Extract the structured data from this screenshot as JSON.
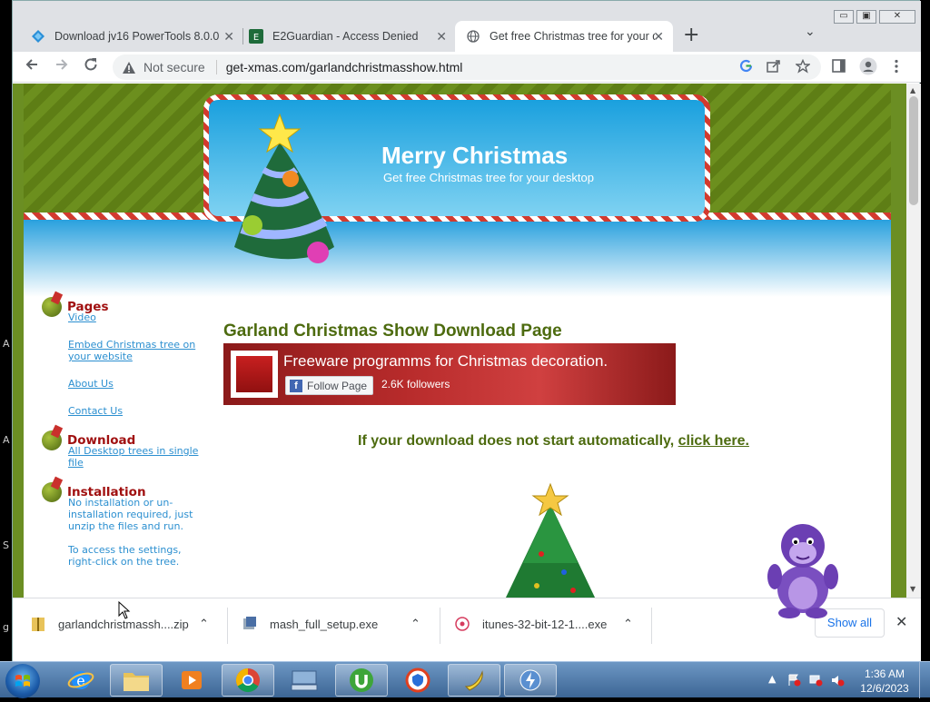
{
  "browser": {
    "tabs": [
      {
        "title": "Download jv16 PowerTools 8.0.0",
        "close": "✕"
      },
      {
        "title": "E2Guardian - Access Denied",
        "close": "✕"
      },
      {
        "title": "Get free Christmas tree for your d",
        "close": "✕"
      }
    ],
    "new_tab": "+",
    "tab_list": "⌄",
    "window_controls": {
      "minimize": "▭",
      "maximize": "▣",
      "close": "✕"
    },
    "security": "Not secure",
    "url": "get-xmas.com/garlandchristmasshow.html"
  },
  "page": {
    "banner_title": "Merry Christmas",
    "banner_subtitle": "Get free Christmas tree for your desktop",
    "nav": {
      "pages_heading": "Pages",
      "video": "Video",
      "embed": "Embed Christmas tree on your website",
      "about": "About Us",
      "contact": "Contact Us",
      "download_heading": "Download",
      "all_trees": "All Desktop trees in single file",
      "installation_heading": "Installation",
      "install_text": "No installation or un-installation required, just unzip the files and run.",
      "settings_text": "To access the settings, right-click on the tree."
    },
    "heading": "Garland Christmas Show Download Page",
    "fb": {
      "headline": "Freeware programms for Christmas decoration.",
      "follow": "Follow Page",
      "f": "f",
      "followers": "2.6K followers"
    },
    "download_msg": "If your download does not start automatically,",
    "download_link": "click here."
  },
  "downloads": {
    "items": [
      {
        "name": "garlandchristmassh....zip"
      },
      {
        "name": "mash_full_setup.exe"
      },
      {
        "name": "itunes-32-bit-12-1....exe"
      }
    ],
    "show_all": "Show all",
    "close": "✕"
  },
  "taskbar": {
    "time": "1:36 AM",
    "date": "12/6/2023"
  },
  "desktop_edge": [
    "A",
    "A",
    "S",
    "g"
  ],
  "colors": {
    "page_green": "#6b8e23",
    "heading_green": "#4d6b0f",
    "nav_red": "#a01010",
    "link_blue": "#2b8fd0"
  }
}
